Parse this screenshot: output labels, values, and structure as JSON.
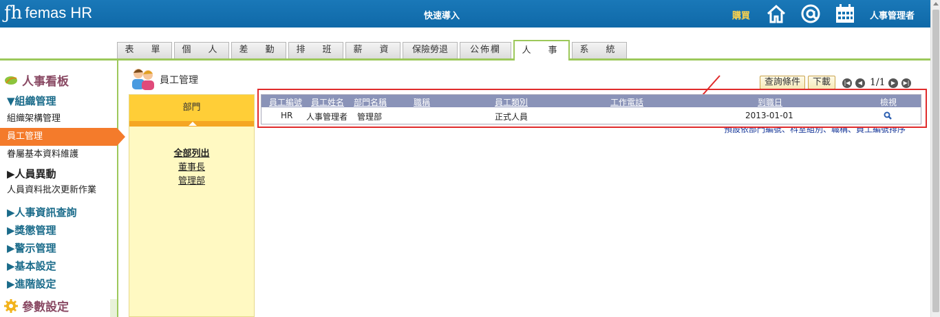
{
  "header": {
    "logo_text": "femas HR",
    "quick_nav": "快速導入",
    "buy": "購買",
    "user": "人事管理者"
  },
  "tabs": [
    {
      "label": "表　單"
    },
    {
      "label": "個　人"
    },
    {
      "label": "差　勤"
    },
    {
      "label": "排　班"
    },
    {
      "label": "薪　資"
    },
    {
      "label": "保險勞退"
    },
    {
      "label": "公佈欄"
    },
    {
      "label": "人　事",
      "active": true
    },
    {
      "label": "系　統"
    }
  ],
  "sidebar": {
    "board_title": "人事看板",
    "groups": {
      "org": "▼組織管理",
      "change": "▶人員異動",
      "query": "▶人事資訊查詢",
      "reward": "▶獎懲管理",
      "alert": "▶警示管理",
      "basic": "▶基本設定",
      "advanced": "▶進階設定"
    },
    "items": {
      "org_structure": "組織架構管理",
      "employee": "員工管理",
      "family": "眷屬基本資料維護",
      "batch": "人員資料批次更新作業"
    },
    "param_title": "參數設定"
  },
  "main": {
    "title": "員工管理",
    "dept_panel": {
      "header": "部門",
      "links": [
        "全部列出",
        "董事長",
        "管理部"
      ]
    },
    "toolbar": {
      "query": "查詢條件",
      "download": "下載",
      "page": "1/1"
    },
    "table": {
      "headers": [
        "員工編號",
        "員工姓名",
        "部門名稱",
        "職稱",
        "員工類別",
        "工作電話",
        "到職日",
        "檢視"
      ],
      "rows": [
        {
          "id": "HR",
          "name": "人事管理者",
          "dept": "管理部",
          "title": "",
          "type": "正式人員",
          "phone": "",
          "hire_date": "2013-01-01"
        }
      ]
    },
    "note": "預設依部門編號、科室組別、職稱、員工編號排序"
  },
  "colors": {
    "header_blue": "#1a78b8",
    "tab_green": "#9cc85a",
    "active_orange": "#f47b2b",
    "highlight_red": "#e02a2a",
    "table_head": "#8a93b8"
  }
}
